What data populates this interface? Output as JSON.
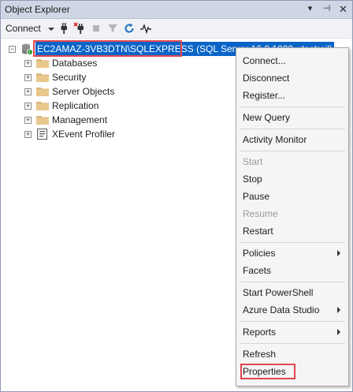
{
  "window": {
    "title": "Object Explorer",
    "buttons": {
      "dropdown": "▾",
      "pin": "⊣",
      "close": "✕"
    }
  },
  "toolbar": {
    "connect_label": "Connect",
    "icons": [
      "connect-plug-icon",
      "disconnect-plug-icon",
      "stop-icon",
      "filter-icon",
      "refresh-icon",
      "activity-monitor-icon"
    ]
  },
  "tree": {
    "server": {
      "name": "EC2AMAZ-3VB3DTN\\SQLEXPRESS",
      "version": "(SQL Server 16.0.1000 - testrail)"
    },
    "nodes": [
      {
        "label": "Databases",
        "icon": "folder-icon"
      },
      {
        "label": "Security",
        "icon": "folder-icon"
      },
      {
        "label": "Server Objects",
        "icon": "folder-icon"
      },
      {
        "label": "Replication",
        "icon": "folder-icon"
      },
      {
        "label": "Management",
        "icon": "folder-icon"
      },
      {
        "label": "XEvent Profiler",
        "icon": "xevent-profiler-icon"
      }
    ]
  },
  "context_menu": {
    "items": [
      {
        "label": "Connect...",
        "enabled": true
      },
      {
        "label": "Disconnect",
        "enabled": true
      },
      {
        "label": "Register...",
        "enabled": true
      },
      {
        "label": "New Query",
        "enabled": true
      },
      {
        "label": "Activity Monitor",
        "enabled": true
      },
      {
        "label": "Start",
        "enabled": false
      },
      {
        "label": "Stop",
        "enabled": true
      },
      {
        "label": "Pause",
        "enabled": true
      },
      {
        "label": "Resume",
        "enabled": false
      },
      {
        "label": "Restart",
        "enabled": true
      },
      {
        "label": "Policies",
        "enabled": true,
        "submenu": true
      },
      {
        "label": "Facets",
        "enabled": true
      },
      {
        "label": "Start PowerShell",
        "enabled": true
      },
      {
        "label": "Azure Data Studio",
        "enabled": true,
        "submenu": true
      },
      {
        "label": "Reports",
        "enabled": true,
        "submenu": true
      },
      {
        "label": "Refresh",
        "enabled": true
      },
      {
        "label": "Properties",
        "enabled": true
      }
    ]
  },
  "colors": {
    "selection": "#0a64c8",
    "highlight_box": "#e0484f",
    "titlebar": "#cfd6e5"
  }
}
